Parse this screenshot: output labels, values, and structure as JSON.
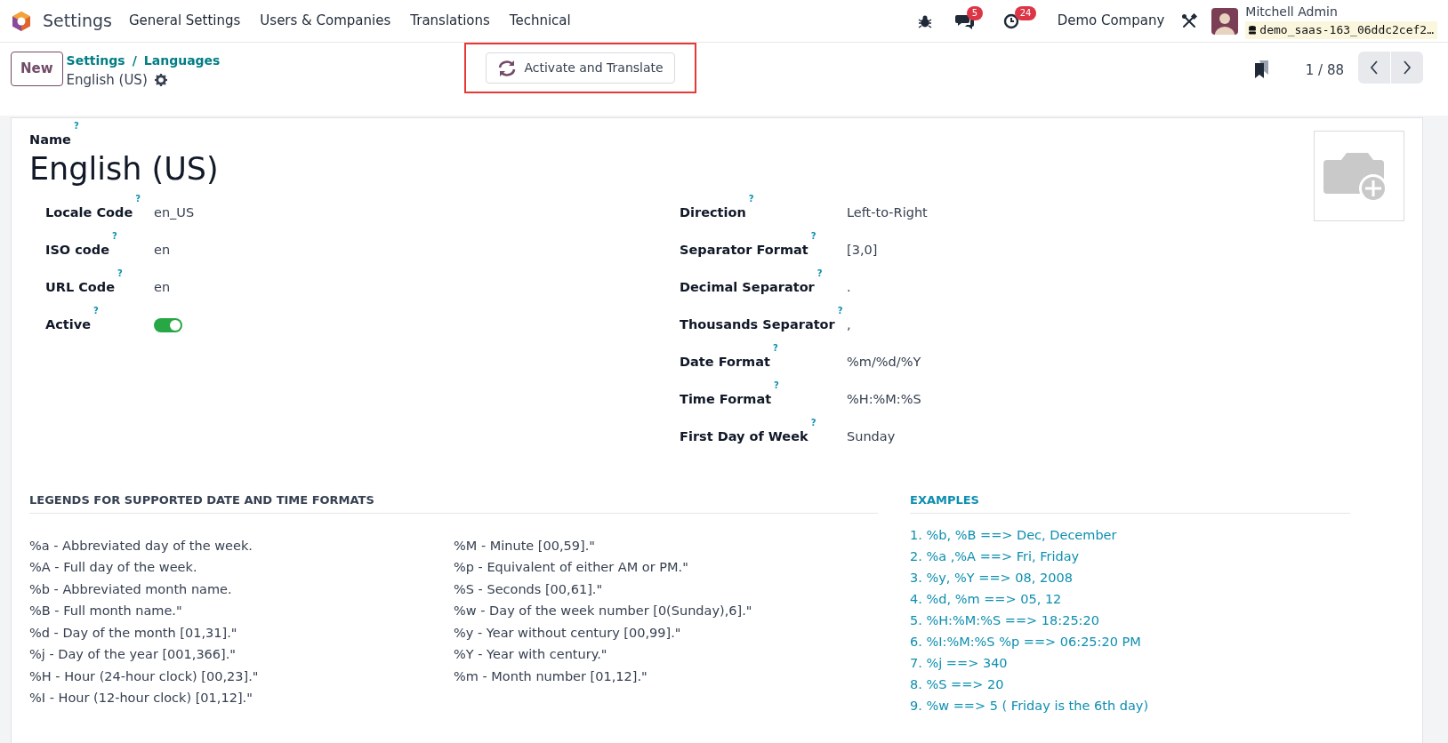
{
  "navbar": {
    "app_name": "Settings",
    "menus": [
      "General Settings",
      "Users & Companies",
      "Translations",
      "Technical"
    ],
    "messages_count": "5",
    "activities_count": "24",
    "company": "Demo Company",
    "user": {
      "name": "Mitchell Admin",
      "database": "demo_saas-163_06ddc2cef2…"
    }
  },
  "control_panel": {
    "new_button": "New",
    "breadcrumbs": [
      "Settings",
      "Languages"
    ],
    "breadcrumb_separator": "/",
    "record_title": "English (US)",
    "action": {
      "label": "Activate and Translate",
      "highlighted": true
    },
    "pager": "1 / 88"
  },
  "form": {
    "name_label": "Name",
    "name_help": "?",
    "name": "English (US)",
    "left_fields": [
      {
        "label": "Locale Code",
        "help": "?",
        "kind": "text",
        "value": "en_US"
      },
      {
        "label": "ISO code",
        "help": "?",
        "kind": "text",
        "value": "en"
      },
      {
        "label": "URL Code",
        "help": "?",
        "kind": "text",
        "value": "en"
      },
      {
        "label": "Active",
        "help": "?",
        "kind": "toggle",
        "on": true
      }
    ],
    "right_fields": [
      {
        "label": "Direction",
        "help": "?",
        "kind": "text",
        "value": "Left-to-Right"
      },
      {
        "label": "Separator Format",
        "help": "?",
        "kind": "text",
        "value": "[3,0]"
      },
      {
        "label": "Decimal Separator",
        "help": "?",
        "kind": "text",
        "value": "."
      },
      {
        "label": "Thousands Separator",
        "help": "?",
        "kind": "text",
        "value": ","
      },
      {
        "label": "Date Format",
        "help": "?",
        "kind": "text",
        "value": "%m/%d/%Y"
      },
      {
        "label": "Time Format",
        "help": "?",
        "kind": "text",
        "value": "%H:%M:%S"
      },
      {
        "label": "First Day of Week",
        "help": "?",
        "kind": "text",
        "value": "Sunday"
      }
    ],
    "legends": {
      "title": "LEGENDS FOR SUPPORTED DATE AND TIME FORMATS",
      "columns": [
        [
          "%a - Abbreviated day of the week.",
          "%A - Full day of the week.",
          "%b - Abbreviated month name.",
          "%B - Full month name.\"",
          "%d - Day of the month [01,31].\"",
          "%j - Day of the year [001,366].\"",
          "%H - Hour (24-hour clock) [00,23].\"",
          "%I - Hour (12-hour clock) [01,12].\""
        ],
        [
          "%M - Minute [00,59].\"",
          "%p - Equivalent of either AM or PM.\"",
          "%S - Seconds [00,61].\"",
          "%w - Day of the week number [0(Sunday),6].\"",
          "%y - Year without century [00,99].\"",
          "%Y - Year with century.\"",
          "%m - Month number [01,12].\""
        ]
      ]
    },
    "examples": {
      "title": "EXAMPLES",
      "items": [
        "1. %b, %B ==> Dec, December",
        "2. %a ,%A ==> Fri, Friday",
        "3. %y, %Y ==> 08, 2008",
        "4. %d, %m ==> 05, 12",
        "5. %H:%M:%S ==> 18:25:20",
        "6. %I:%M:%S %p ==> 06:25:20 PM",
        "7. %j ==> 340",
        "8. %S ==> 20",
        "9. %w ==> 5 ( Friday is the 6th day)"
      ]
    }
  }
}
